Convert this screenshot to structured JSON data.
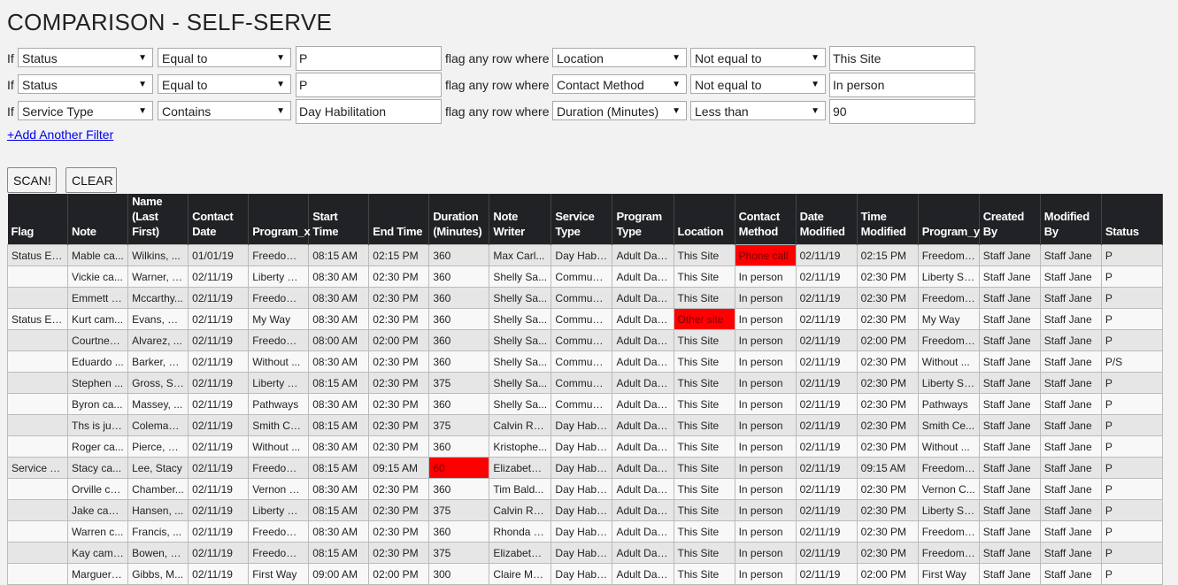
{
  "page": {
    "title": "COMPARISON - SELF-SERVE",
    "flag_label": "flag any row where",
    "if_label": "If",
    "add_filter_link": "+Add Another Filter",
    "scan_button": "SCAN!",
    "clear_button": "CLEAR"
  },
  "filters": [
    {
      "field": "Status",
      "operator": "Equal to",
      "value": "P",
      "flag_field": "Location",
      "flag_operator": "Not equal to",
      "flag_value": "This Site"
    },
    {
      "field": "Status",
      "operator": "Equal to",
      "value": "P",
      "flag_field": "Contact Method",
      "flag_operator": "Not equal to",
      "flag_value": "In person"
    },
    {
      "field": "Service Type",
      "operator": "Contains",
      "value": "Day Habilitation",
      "flag_field": "Duration (Minutes)",
      "flag_operator": "Less than",
      "flag_value": "90"
    }
  ],
  "table": {
    "columns": [
      "Flag",
      "Note",
      "Name (Last First)",
      "Contact Date",
      "Program_x",
      "Start Time",
      "End Time",
      "Duration (Minutes)",
      "Note Writer",
      "Service Type",
      "Program Type",
      "Location",
      "Contact Method",
      "Date Modified",
      "Time Modified",
      "Program_y",
      "Created By",
      "Modified By",
      "Status"
    ],
    "highlight_color": "#ff0000",
    "highlights": [
      [
        0,
        12
      ],
      [
        3,
        11
      ],
      [
        10,
        7
      ]
    ],
    "rows": [
      [
        "Status Eq...",
        "Mable ca...",
        "Wilkins, ...",
        "01/01/19",
        "Freedom ...",
        "08:15 AM",
        "02:15 PM",
        "360",
        "Max Carl...",
        "Day Habil...",
        "Adult Day...",
        "This Site",
        "Phone call",
        "02/11/19",
        "02:15 PM",
        "Freedom ...",
        "Staff Jane",
        "Staff Jane",
        "P"
      ],
      [
        "",
        "Vickie ca...",
        "Warner, V...",
        "02/11/19",
        "Liberty St...",
        "08:30 AM",
        "02:30 PM",
        "360",
        "Shelly Sa...",
        "Communi...",
        "Adult Day...",
        "This Site",
        "In person",
        "02/11/19",
        "02:30 PM",
        "Liberty St...",
        "Staff Jane",
        "Staff Jane",
        "P"
      ],
      [
        "",
        "Emmett c...",
        "Mccarthy...",
        "02/11/19",
        "Freedom ...",
        "08:30 AM",
        "02:30 PM",
        "360",
        "Shelly Sa...",
        "Communi...",
        "Adult Day...",
        "This Site",
        "In person",
        "02/11/19",
        "02:30 PM",
        "Freedom ...",
        "Staff Jane",
        "Staff Jane",
        "P"
      ],
      [
        "Status Eq...",
        "Kurt cam...",
        "Evans, Kurt",
        "02/11/19",
        "My Way",
        "08:30 AM",
        "02:30 PM",
        "360",
        "Shelly Sa...",
        "Communi...",
        "Adult Day...",
        "Other site",
        "In person",
        "02/11/19",
        "02:30 PM",
        "My Way",
        "Staff Jane",
        "Staff Jane",
        "P"
      ],
      [
        "",
        "Courtney ...",
        "Alvarez, ...",
        "02/11/19",
        "Freedom ...",
        "08:00 AM",
        "02:00 PM",
        "360",
        "Shelly Sa...",
        "Communi...",
        "Adult Day...",
        "This Site",
        "In person",
        "02/11/19",
        "02:00 PM",
        "Freedom ...",
        "Staff Jane",
        "Staff Jane",
        "P"
      ],
      [
        "",
        "Eduardo ...",
        "Barker, E...",
        "02/11/19",
        "Without ...",
        "08:30 AM",
        "02:30 PM",
        "360",
        "Shelly Sa...",
        "Communi...",
        "Adult Day...",
        "This Site",
        "In person",
        "02/11/19",
        "02:30 PM",
        "Without ...",
        "Staff Jane",
        "Staff Jane",
        "P/S"
      ],
      [
        "",
        "Stephen ...",
        "Gross, St...",
        "02/11/19",
        "Liberty St...",
        "08:15 AM",
        "02:30 PM",
        "375",
        "Shelly Sa...",
        "Communi...",
        "Adult Day...",
        "This Site",
        "In person",
        "02/11/19",
        "02:30 PM",
        "Liberty St...",
        "Staff Jane",
        "Staff Jane",
        "P"
      ],
      [
        "",
        "Byron ca...",
        "Massey, ...",
        "02/11/19",
        "Pathways",
        "08:30 AM",
        "02:30 PM",
        "360",
        "Shelly Sa...",
        "Communi...",
        "Adult Day...",
        "This Site",
        "In person",
        "02/11/19",
        "02:30 PM",
        "Pathways",
        "Staff Jane",
        "Staff Jane",
        "P"
      ],
      [
        "",
        "Ths is jus...",
        "Coleman,...",
        "02/11/19",
        "Smith Ce...",
        "08:15 AM",
        "02:30 PM",
        "375",
        "Calvin Ro...",
        "Day Habil...",
        "Adult Day...",
        "This Site",
        "In person",
        "02/11/19",
        "02:30 PM",
        "Smith Ce...",
        "Staff Jane",
        "Staff Jane",
        "P"
      ],
      [
        "",
        "Roger ca...",
        "Pierce, R...",
        "02/11/19",
        "Without ...",
        "08:30 AM",
        "02:30 PM",
        "360",
        "Kristophe...",
        "Day Habil...",
        "Adult Day...",
        "This Site",
        "In person",
        "02/11/19",
        "02:30 PM",
        "Without ...",
        "Staff Jane",
        "Staff Jane",
        "P"
      ],
      [
        "Service T...",
        "Stacy ca...",
        "Lee, Stacy",
        "02/11/19",
        "Freedom ...",
        "08:15 AM",
        "09:15 AM",
        "60",
        "Elizabeth ...",
        "Day Habil...",
        "Adult Day...",
        "This Site",
        "In person",
        "02/11/19",
        "09:15 AM",
        "Freedom ...",
        "Staff Jane",
        "Staff Jane",
        "P"
      ],
      [
        "",
        "Orville ca...",
        "Chamber...",
        "02/11/19",
        "Vernon C...",
        "08:30 AM",
        "02:30 PM",
        "360",
        "Tim Bald...",
        "Day Habil...",
        "Adult Day...",
        "This Site",
        "In person",
        "02/11/19",
        "02:30 PM",
        "Vernon C...",
        "Staff Jane",
        "Staff Jane",
        "P"
      ],
      [
        "",
        "Jake cam...",
        "Hansen, ...",
        "02/11/19",
        "Liberty St...",
        "08:15 AM",
        "02:30 PM",
        "375",
        "Calvin Ro...",
        "Day Habil...",
        "Adult Day...",
        "This Site",
        "In person",
        "02/11/19",
        "02:30 PM",
        "Liberty St...",
        "Staff Jane",
        "Staff Jane",
        "P"
      ],
      [
        "",
        "Warren c...",
        "Francis, ...",
        "02/11/19",
        "Freedom ...",
        "08:30 AM",
        "02:30 PM",
        "360",
        "Rhonda K...",
        "Day Habil...",
        "Adult Day...",
        "This Site",
        "In person",
        "02/11/19",
        "02:30 PM",
        "Freedom ...",
        "Staff Jane",
        "Staff Jane",
        "P"
      ],
      [
        "",
        "Kay came...",
        "Bowen, K...",
        "02/11/19",
        "Freedom ...",
        "08:15 AM",
        "02:30 PM",
        "375",
        "Elizabeth ...",
        "Day Habil...",
        "Adult Day...",
        "This Site",
        "In person",
        "02/11/19",
        "02:30 PM",
        "Freedom ...",
        "Staff Jane",
        "Staff Jane",
        "P"
      ],
      [
        "",
        "Marguerit...",
        "Gibbs, M...",
        "02/11/19",
        "First Way",
        "09:00 AM",
        "02:00 PM",
        "300",
        "Claire Ma...",
        "Day Habil...",
        "Adult Day...",
        "This Site",
        "In person",
        "02/11/19",
        "02:00 PM",
        "First Way",
        "Staff Jane",
        "Staff Jane",
        "P"
      ]
    ]
  }
}
